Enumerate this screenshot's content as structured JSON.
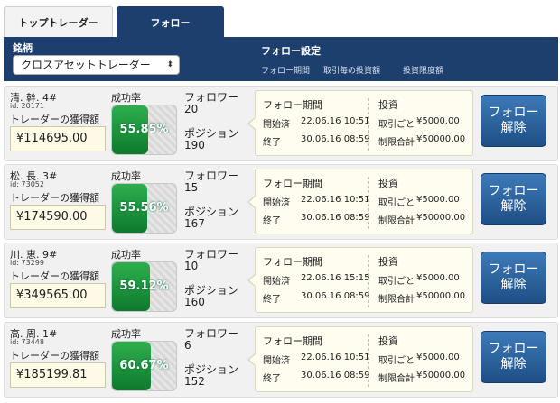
{
  "tabs": {
    "top_traders": "トップトレーダー",
    "follow": "フォロー"
  },
  "header": {
    "symbol_label": "銘柄",
    "symbol_select": "クロスアセットトレーダー",
    "follow_settings": "フォロー設定",
    "col_period": "フォロー期間",
    "col_per_trade": "取引毎の投資額",
    "col_limit": "投資限度額"
  },
  "labels": {
    "earnings": "トレーダーの獲得額",
    "success_rate": "成功率",
    "followers": "フォロワー",
    "positions": "ポジション",
    "follow_period": "フォロー期間",
    "started": "開始済",
    "ended": "終了",
    "investment": "投資",
    "per_trade": "取引ごと",
    "limit_total": "制限合計",
    "unfollow_line1": "フォロー",
    "unfollow_line2": "解除"
  },
  "traders": [
    {
      "name": "清. 幹.  4#",
      "id": "id: 20171",
      "earnings": "¥114695.00",
      "success_rate": "55.85%",
      "success_pct": 55.85,
      "followers": "20",
      "positions": "190",
      "start": "22.06.16 10:51",
      "end": "30.06.16 08:59",
      "per_trade": "¥5000.00",
      "limit": "¥50000.00"
    },
    {
      "name": "松. 長.  3#",
      "id": "id: 73052",
      "earnings": "¥174590.00",
      "success_rate": "55.56%",
      "success_pct": 55.56,
      "followers": "15",
      "positions": "167",
      "start": "22.06.16 10:51",
      "end": "30.06.16 08:59",
      "per_trade": "¥5000.00",
      "limit": "¥50000.00"
    },
    {
      "name": "川. 恵.  9#",
      "id": "id: 73299",
      "earnings": "¥349565.00",
      "success_rate": "59.12%",
      "success_pct": 59.12,
      "followers": "10",
      "positions": "160",
      "start": "22.06.16 15:15",
      "end": "30.06.16 08:59",
      "per_trade": "¥5000.00",
      "limit": "¥50000.00"
    },
    {
      "name": "高. 周.  1#",
      "id": "id: 73448",
      "earnings": "¥185199.81",
      "success_rate": "60.67%",
      "success_pct": 60.67,
      "followers": "6",
      "positions": "152",
      "start": "22.06.16 10:51",
      "end": "30.06.16 08:59",
      "per_trade": "¥5000.00",
      "limit": "¥50000.00"
    }
  ],
  "colors": {
    "header_bg": "#1c3f6e",
    "gauge_green": "#1a9a3e",
    "unfollow_blue": "#2d65a0"
  }
}
